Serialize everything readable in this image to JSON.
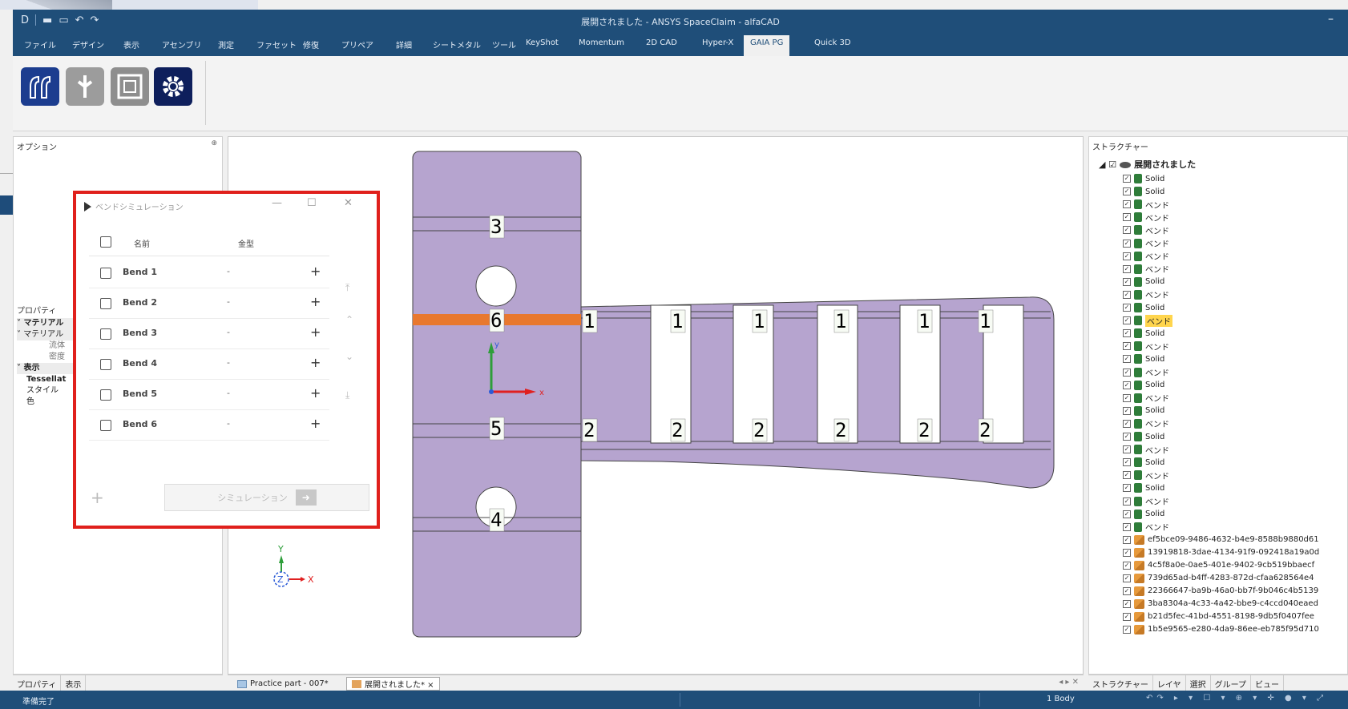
{
  "window": {
    "title": "展開されました - ANSYS SpaceClaim - alfaCAD",
    "minimize": "–"
  },
  "quick_access": [
    "D",
    "|",
    "▬",
    "▭",
    "↶",
    "↷"
  ],
  "menu": {
    "items": [
      "ファイル",
      "デザイン",
      "表示",
      "アセンブリ",
      "測定",
      "ファセット",
      "修復",
      "プリペア",
      "詳細",
      "シートメタル",
      "ツール",
      "KeyShot",
      "Momentum",
      "2D CAD",
      "Hyper-X",
      "GAIA PG",
      "Quick 3D"
    ],
    "active": "GAIA PG"
  },
  "ribbon": {
    "buttons": [
      "bend-tool",
      "connect-tool",
      "frame-tool",
      "settings-tool"
    ]
  },
  "left_panel": {
    "options_title": "オプション",
    "pin": "⊕",
    "properties_title": "プロパティ",
    "tree": [
      {
        "text": "マテリアル",
        "level": 0,
        "bold": true
      },
      {
        "text": "マテリアル",
        "level": 1,
        "bold": false
      },
      {
        "text": "流体",
        "level": 2,
        "bold": false
      },
      {
        "text": "密度",
        "level": 2,
        "bold": false
      },
      {
        "text": "表示",
        "level": 0,
        "bold": true
      },
      {
        "text": "Tessellat",
        "level": 1,
        "bold": true
      },
      {
        "text": "スタイル",
        "level": 1,
        "bold": false
      },
      {
        "text": "色",
        "level": 1,
        "bold": false
      }
    ],
    "tabs": [
      "プロパティ",
      "表示"
    ]
  },
  "dialog": {
    "title": "ベンドシミュレーション",
    "controls": [
      "—",
      "☐",
      "✕"
    ],
    "col_name": "名前",
    "col_type": "金型",
    "rows": [
      {
        "name": "Bend 1",
        "type": "-",
        "action": "+"
      },
      {
        "name": "Bend 2",
        "type": "-",
        "action": "+"
      },
      {
        "name": "Bend 3",
        "type": "-",
        "action": "+"
      },
      {
        "name": "Bend 4",
        "type": "-",
        "action": "+"
      },
      {
        "name": "Bend 5",
        "type": "-",
        "action": "+"
      },
      {
        "name": "Bend 6",
        "type": "-",
        "action": "+"
      }
    ],
    "side_arrows": [
      "⤒",
      "⌃",
      "⌄",
      "⤓"
    ],
    "add": "+",
    "simulate_label": "シミュレーション",
    "simulate_arrow": "➜"
  },
  "viewport": {
    "part_color": "#b6a4cf",
    "highlight_color": "#e8782e",
    "line_labels_left": [
      "3",
      "6",
      "5",
      "4"
    ],
    "labels_top": [
      "1",
      "1",
      "1",
      "1",
      "1",
      "1"
    ],
    "labels_bottom": [
      "2",
      "2",
      "2",
      "2",
      "2",
      "2"
    ],
    "axis_x": "X",
    "axis_y": "Y",
    "axis_z": "Z",
    "triad_x": "x",
    "triad_y": "y"
  },
  "doc_tabs": [
    {
      "label": "Practice part - 007*",
      "active": false
    },
    {
      "label": "展開されました* ×",
      "active": true
    }
  ],
  "doc_nav": "◂ ▸ ✕",
  "structure": {
    "title": "ストラクチャー",
    "root": "展開されました",
    "bodies": [
      "Solid",
      "Solid",
      "ベンド",
      "ベンド",
      "ベンド",
      "ベンド",
      "ベンド",
      "ベンド",
      "Solid",
      "ベンド",
      "Solid",
      "ベンド",
      "Solid",
      "ベンド",
      "Solid",
      "ベンド",
      "Solid",
      "ベンド",
      "Solid",
      "ベンド",
      "Solid",
      "ベンド",
      "Solid",
      "ベンド",
      "Solid",
      "ベンド",
      "Solid",
      "ベンド"
    ],
    "highlighted_index": 11,
    "components": [
      "ef5bce09-9486-4632-b4e9-8588b9880d61",
      "13919818-3dae-4134-91f9-092418a19a0d",
      "4c5f8a0e-0ae5-401e-9402-9cb519bbaecf",
      "739d65ad-b4ff-4283-872d-cfaa628564e4",
      "22366647-ba9b-46a0-bb7f-9b046c4b5139",
      "3ba8304a-4c33-4a42-bbe9-c4ccd040eaed",
      "b21d5fec-41bd-4551-8198-9db5f0407fee",
      "1b5e9565-e280-4da9-86ee-eb785f95d710"
    ],
    "tabs": [
      "ストラクチャー",
      "レイヤ",
      "選択",
      "グループ",
      "ビュー"
    ]
  },
  "status": {
    "text": "準備完了",
    "bodies": "1 Body",
    "icons": "↶↷ ▸ ▾ ☐ ▾ ⊕ ▾ ✛ ● ▾ ⤢"
  }
}
